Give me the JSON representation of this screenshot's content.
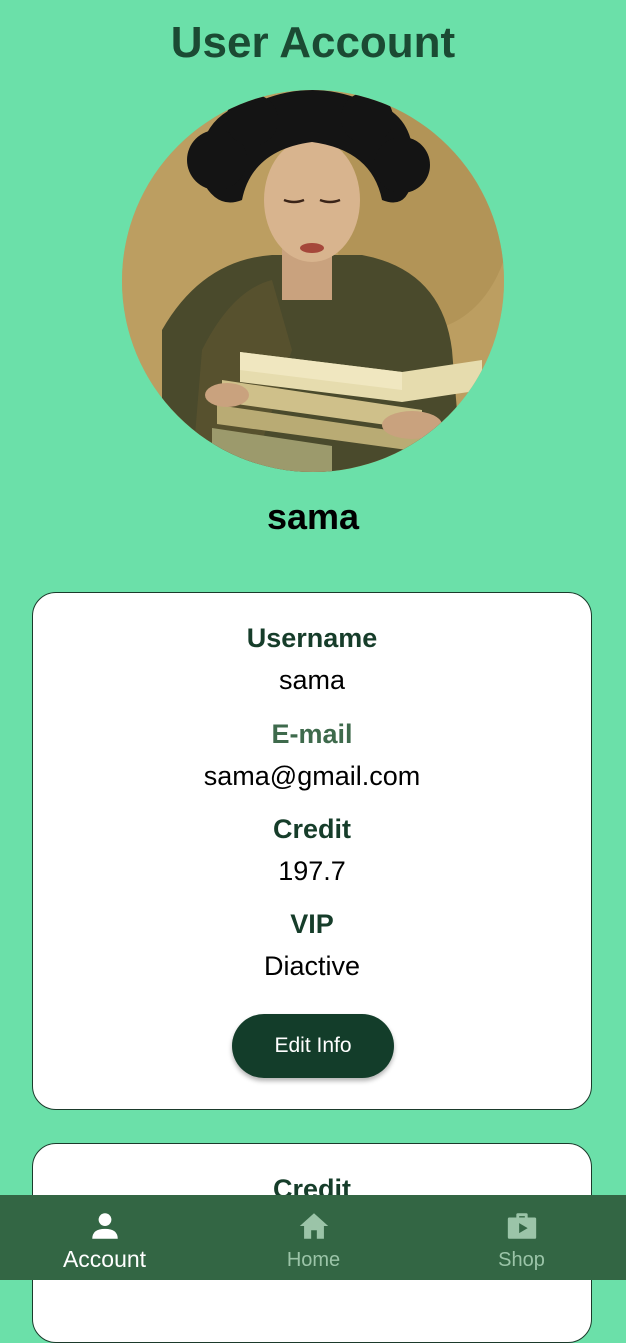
{
  "header": {
    "title": "User Account"
  },
  "profile": {
    "display_name": "sama"
  },
  "account_card": {
    "fields": [
      {
        "label": "Username",
        "value": "sama"
      },
      {
        "label": "E-mail",
        "value": "sama@gmail.com"
      },
      {
        "label": "Credit",
        "value": "197.7"
      },
      {
        "label": "VIP",
        "value": "Diactive"
      }
    ],
    "edit_button_label": "Edit Info"
  },
  "credit_card": {
    "label": "Credit"
  },
  "bottom_nav": {
    "items": [
      {
        "label": "Account",
        "icon": "person-icon",
        "active": true
      },
      {
        "label": "Home",
        "icon": "home-icon",
        "active": false
      },
      {
        "label": "Shop",
        "icon": "shop-bag-icon",
        "active": false
      }
    ]
  },
  "colors": {
    "background": "#6be0a9",
    "title": "#1b4a33",
    "button": "#133d2a",
    "nav_bar": "#336644",
    "nav_inactive": "#9bc4a8"
  }
}
